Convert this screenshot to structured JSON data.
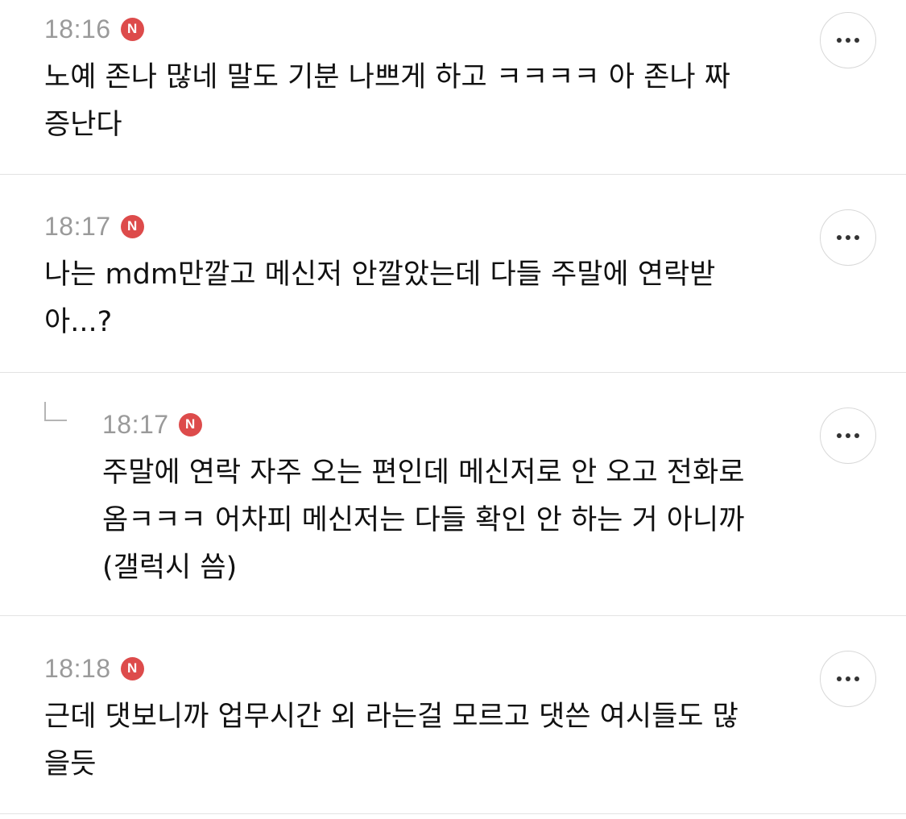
{
  "comments": [
    {
      "time": "18:16",
      "badge": "N",
      "line1": "노예 존나 많네 말도 기분 나쁘게 하고 ㅋㅋㅋㅋ 아 존나 짜",
      "line2": "증난다",
      "more_icon": "more-horizontal-icon"
    },
    {
      "time": "18:17",
      "badge": "N",
      "line1": "나는 mdm만깔고 메신저 안깔았는데 다들 주말에 연락받",
      "line2": "아...?",
      "more_icon": "more-horizontal-icon"
    },
    {
      "time": "18:17",
      "badge": "N",
      "is_reply": true,
      "reply_icon": "reply-arrow-icon",
      "line1": "주말에 연락 자주 오는 편인데 메신저로 안 오고 전화로",
      "line2": "옴ㅋㅋㅋ 어차피 메신저는 다들 확인 안 하는 거 아니까",
      "line3": "(갤럭시 씀)",
      "more_icon": "more-horizontal-icon"
    },
    {
      "time": "18:18",
      "badge": "N",
      "line1": "근데 댓보니까 업무시간 외 라는걸 모르고 댓쓴 여시들도 많",
      "line2": "을듯",
      "more_icon": "more-horizontal-icon"
    }
  ],
  "colors": {
    "badge": "#dd4b4b",
    "time": "#9a9a9a",
    "divider": "#e3e3e3",
    "text": "#111111"
  }
}
